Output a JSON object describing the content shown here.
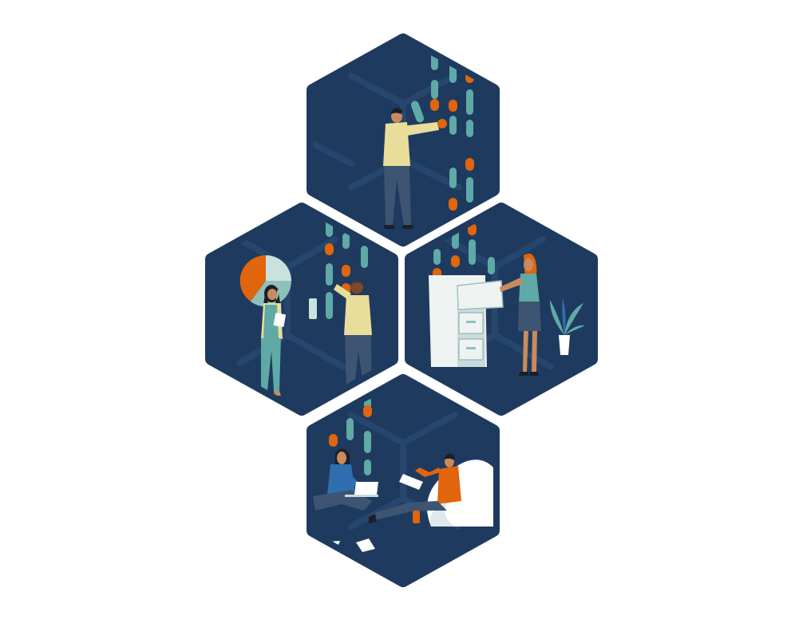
{
  "colors": {
    "background": "#ffffff",
    "navy": "#1e3a5f",
    "navy_line": "#27466d",
    "teal": "#5fa9a6",
    "orange": "#e0650c",
    "khaki": "#e8dd9a",
    "slate": "#3d5473",
    "skin": "#c98a5e",
    "dark_skin": "#7a4a2f",
    "hair": "#1a1f2b",
    "cabinet": "#eef3f2",
    "cabinet_shade": "#c9dcdb",
    "blue_shirt": "#2f6fb0",
    "pie_light": "#c9e2de",
    "pie_mid": "#8fc1bb"
  },
  "scenes": [
    {
      "name": "data-wall-scene",
      "icon": "person-arranging-data-icon"
    },
    {
      "name": "pie-chart-discussion-scene",
      "icon": "pie-chart-icon"
    },
    {
      "name": "filing-cabinet-scene",
      "icon": "filing-cabinet-icon"
    },
    {
      "name": "laptop-collaboration-scene",
      "icon": "laptop-icon"
    }
  ]
}
